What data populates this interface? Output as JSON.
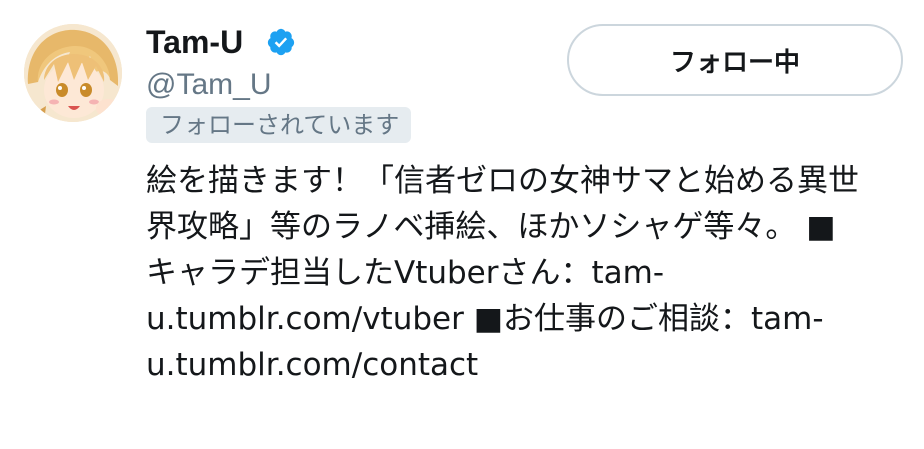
{
  "profile": {
    "display_name": "Tam-U",
    "handle": "@Tam_U",
    "follows_you_badge": "フォローされています",
    "follow_button_label": "フォロー中",
    "verified_icon": "verified-badge-icon",
    "verified_color": "#1da1f2"
  },
  "bio": {
    "line1": "絵を描きます！「信者ゼロの女神サマと始める異世",
    "line2": "界攻略」等のラノベ挿絵、ほかソシャゲ等々。 ■",
    "line3_text": "キャラデ担当したVtuberさん：",
    "line3_link": "tam-",
    "line4_link": "u.tumblr.com/vtuber",
    "line4_text": " ■お仕事のご相談：",
    "line4_link2": "tam-",
    "line5_link": "u.tumblr.com/contact"
  }
}
